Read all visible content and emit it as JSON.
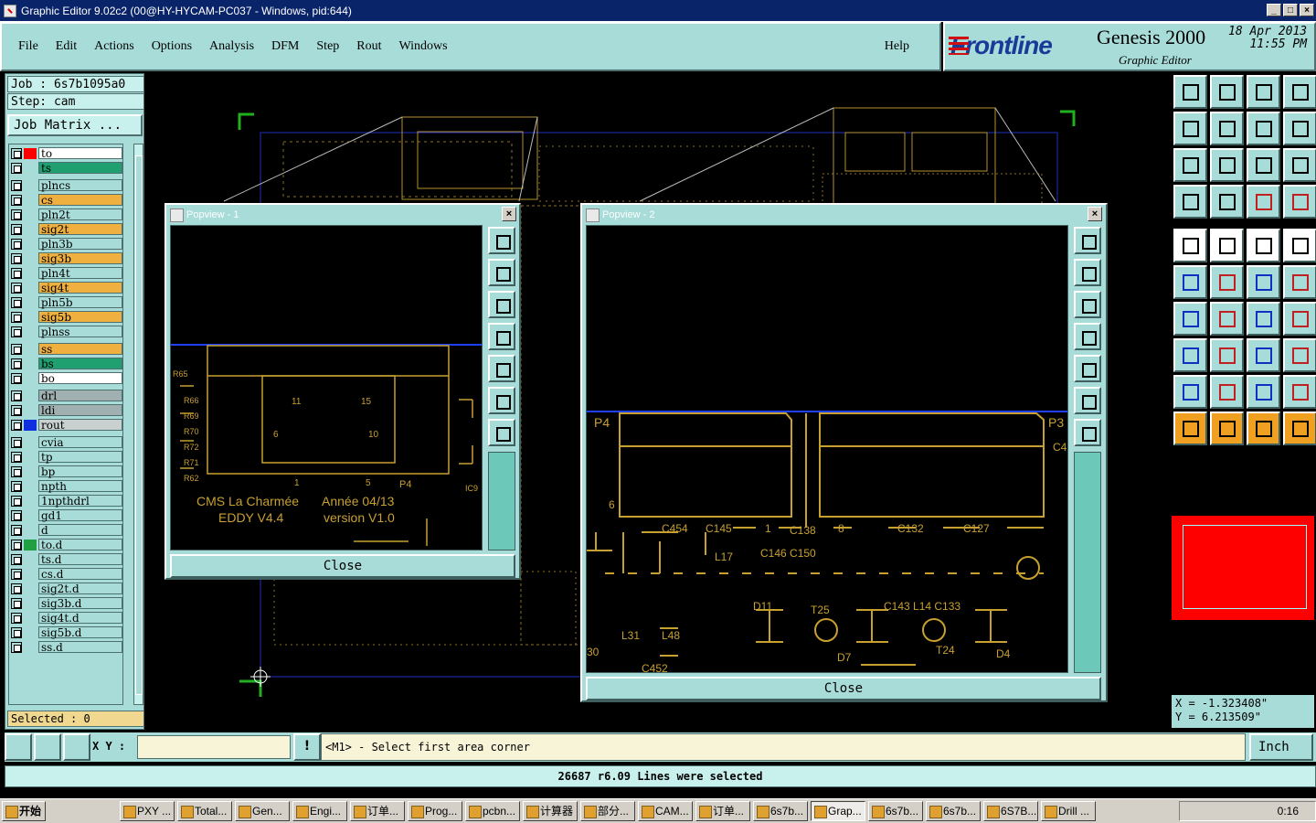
{
  "window": {
    "title": "Graphic Editor 9.02c2 (00@HY-HYCAM-PC037 - Windows, pid:644)"
  },
  "menu": {
    "items": [
      "File",
      "Edit",
      "Actions",
      "Options",
      "Analysis",
      "DFM",
      "Step",
      "Rout",
      "Windows"
    ],
    "help": "Help"
  },
  "brand": {
    "logo": "Frontline",
    "product": "Genesis 2000",
    "subtitle": "Graphic Editor",
    "date": "18 Apr 2013",
    "time": "11:55 PM"
  },
  "job": {
    "job_label": "Job : 6s7b1095a0",
    "step_label": "Step: cam",
    "matrix_button": "Job Matrix ..."
  },
  "layers": [
    {
      "name": "to",
      "color": "#ff0000",
      "bg": "#ffffff"
    },
    {
      "name": "ts",
      "color": "",
      "bg": "#20a070"
    },
    {
      "name": "plncs",
      "color": "",
      "bg": "#a8dcd8"
    },
    {
      "name": "cs",
      "color": "",
      "bg": "#f0b040"
    },
    {
      "name": "pln2t",
      "color": "",
      "bg": "#a8dcd8"
    },
    {
      "name": "sig2t",
      "color": "",
      "bg": "#f0b040"
    },
    {
      "name": "pln3b",
      "color": "",
      "bg": "#a8dcd8"
    },
    {
      "name": "sig3b",
      "color": "",
      "bg": "#f0b040"
    },
    {
      "name": "pln4t",
      "color": "",
      "bg": "#a8dcd8"
    },
    {
      "name": "sig4t",
      "color": "",
      "bg": "#f0b040"
    },
    {
      "name": "pln5b",
      "color": "",
      "bg": "#a8dcd8"
    },
    {
      "name": "sig5b",
      "color": "",
      "bg": "#f0b040"
    },
    {
      "name": "plnss",
      "color": "",
      "bg": "#a8dcd8"
    },
    {
      "name": "ss",
      "color": "",
      "bg": "#f0b040"
    },
    {
      "name": "bs",
      "color": "",
      "bg": "#20a070"
    },
    {
      "name": "bo",
      "color": "",
      "bg": "#ffffff"
    },
    {
      "name": "drl",
      "color": "",
      "bg": "#a0b0b0"
    },
    {
      "name": "ldi",
      "color": "",
      "bg": "#a0b0b0"
    },
    {
      "name": "rout",
      "color": "#1030e0",
      "bg": "#c8d0d0"
    },
    {
      "name": "cvia",
      "color": "",
      "bg": "#a8dcd8"
    },
    {
      "name": "tp",
      "color": "",
      "bg": "#a8dcd8"
    },
    {
      "name": "bp",
      "color": "",
      "bg": "#a8dcd8"
    },
    {
      "name": "npth",
      "color": "",
      "bg": "#a8dcd8"
    },
    {
      "name": "1npthdrl",
      "color": "",
      "bg": "#a8dcd8"
    },
    {
      "name": "gd1",
      "color": "",
      "bg": "#a8dcd8"
    },
    {
      "name": "d",
      "color": "",
      "bg": "#a8dcd8"
    },
    {
      "name": "to.d",
      "color": "#20a040",
      "bg": "#a8dcd8"
    },
    {
      "name": "ts.d",
      "color": "",
      "bg": "#a8dcd8"
    },
    {
      "name": "cs.d",
      "color": "",
      "bg": "#a8dcd8"
    },
    {
      "name": "sig2t.d",
      "color": "",
      "bg": "#a8dcd8"
    },
    {
      "name": "sig3b.d",
      "color": "",
      "bg": "#a8dcd8"
    },
    {
      "name": "sig4t.d",
      "color": "",
      "bg": "#a8dcd8"
    },
    {
      "name": "sig5b.d",
      "color": "",
      "bg": "#a8dcd8"
    },
    {
      "name": "ss.d",
      "color": "",
      "bg": "#a8dcd8"
    }
  ],
  "selected": "Selected : 0",
  "popview1": {
    "title": "Popview - 1",
    "close": "Close",
    "text1": "CMS  La Charmée",
    "text2": "Année 04/13",
    "text3": "EDDY V4.4",
    "text4": "version V1.0"
  },
  "popview2": {
    "title": "Popview - 2",
    "close": "Close"
  },
  "coords": {
    "x": "X = -1.323408\"",
    "y": "Y =  6.213509\""
  },
  "command": {
    "xy_label": "X Y :",
    "prompt": "<M1> - Select first area corner",
    "units": "Inch"
  },
  "status": "26687 r6.09 Lines were selected",
  "taskbar": {
    "start": "开始",
    "tasks": [
      "PXY ...",
      "Total...",
      "Gen...",
      "Engi...",
      "订单...",
      "Prog...",
      "pcbn...",
      "计算器",
      "部分...",
      "CAM...",
      "订单...",
      "6s7b...",
      "Grap...",
      "6s7b...",
      "6s7b...",
      "6S7B...",
      "Drill ..."
    ],
    "clock": "0:16"
  }
}
